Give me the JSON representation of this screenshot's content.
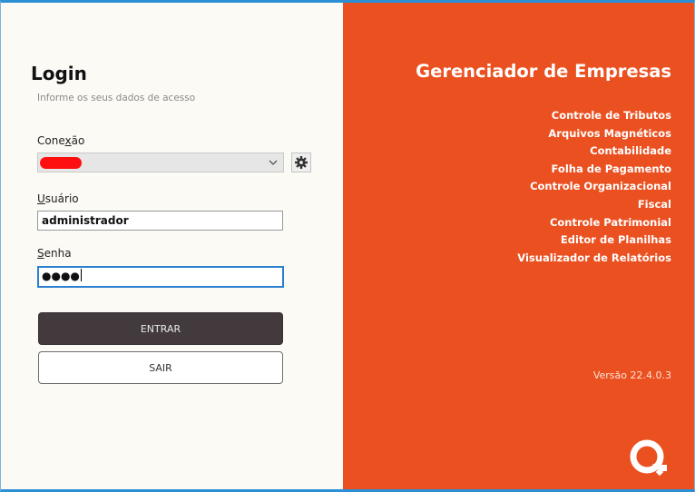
{
  "login": {
    "title": "Login",
    "subtitle": "Informe os seus dados de acesso",
    "connection": {
      "label_pre": "Cone",
      "label_accel": "x",
      "label_post": "ão",
      "value_redacted": true
    },
    "user": {
      "label_accel": "U",
      "label_post": "suário",
      "value": "administrador"
    },
    "password": {
      "label_accel": "S",
      "label_post": "enha",
      "masked_value": "●●●●"
    },
    "enter_label": "ENTRAR",
    "exit_label": "SAIR"
  },
  "brand": {
    "title": "Gerenciador de Empresas",
    "modules": [
      "Controle de Tributos",
      "Arquivos Magnéticos",
      "Contabilidade",
      "Folha de Pagamento",
      "Controle Organizacional",
      "Fiscal",
      "Controle Patrimonial",
      "Editor de Planilhas",
      "Visualizador de Relatórios"
    ],
    "version": "Versão 22.4.0.3",
    "logo_icon": "q-logo-icon"
  },
  "colors": {
    "brand_orange": "#ea5020",
    "enter_button": "#423a3d",
    "focus_border": "#2b7fd0",
    "window_border": "#2b8fd6",
    "left_background": "#fbfaf5"
  },
  "icons": {
    "connection_dropdown": "chevron-down-icon",
    "connection_settings": "gear-icon"
  }
}
